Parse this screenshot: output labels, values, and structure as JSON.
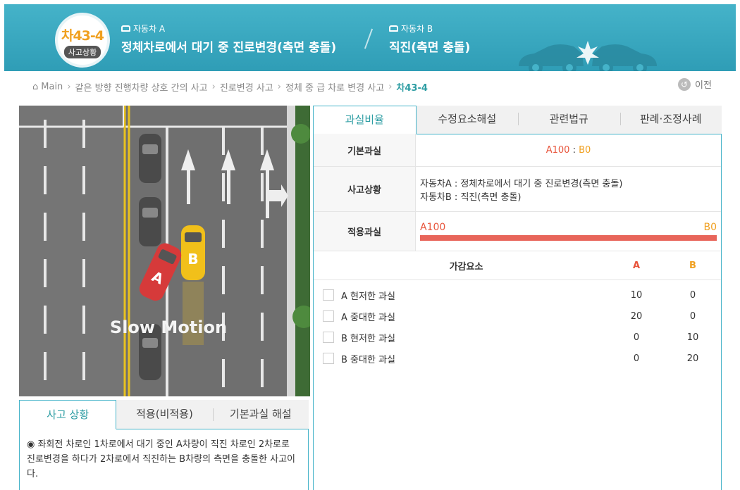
{
  "header": {
    "badge_code": "차43-4",
    "badge_sub": "사고상황",
    "vehicle_a_label": "자동차 A",
    "vehicle_a_desc": "정체차로에서 대기 중 진로변경(측면 충돌)",
    "vehicle_b_label": "자동차 B",
    "vehicle_b_desc": "직진(측면 충돌)"
  },
  "breadcrumb": {
    "items": [
      "Main",
      "같은 방향 진행차량 상호 간의 사고",
      "진로변경 사고",
      "정체 중 급 차로 변경 사고"
    ],
    "current": "차43-4",
    "prev_label": "이전"
  },
  "scene": {
    "caption": "Slow Motion",
    "car_a": "A",
    "car_b": "B"
  },
  "left_tabs": [
    "사고 상황",
    "적용(비적용)",
    "기본과실 해설"
  ],
  "left_desc": "◉ 좌회전 차로인 1차로에서 대기 중인 A차량이 직진 차로인 2차로로 진로변경을 하다가 2차로에서 직진하는 B차량의 측면을 충돌한 사고이다.",
  "right_tabs": [
    "과실비율",
    "수정요소해설",
    "관련법규",
    "판례·조정사례"
  ],
  "fault": {
    "base_label": "기본과실",
    "base_a": "A100",
    "base_sep": ":",
    "base_b": "B0",
    "situation_label": "사고상황",
    "situation_a": "자동차A : 정체차로에서 대기 중 진로변경(측면 충돌)",
    "situation_b": "자동차B : 직진(측면 충돌)",
    "applied_label": "적용과실",
    "applied_a": "A100",
    "applied_b": "B0",
    "applied_a_fraction": 1.0
  },
  "adjust": {
    "header": "가감요소",
    "col_a": "A",
    "col_b": "B",
    "rows": [
      {
        "label": "A 현저한 과실",
        "a": "10",
        "b": "0"
      },
      {
        "label": "A 중대한 과실",
        "a": "20",
        "b": "0"
      },
      {
        "label": "B 현저한 과실",
        "a": "0",
        "b": "10"
      },
      {
        "label": "B 중대한 과실",
        "a": "0",
        "b": "20"
      }
    ]
  },
  "colors": {
    "accent": "#45b3c9",
    "active_text": "#2d9da3",
    "fault_a": "#e8553c",
    "fault_b": "#f0a020",
    "bar": "#e8655a"
  }
}
